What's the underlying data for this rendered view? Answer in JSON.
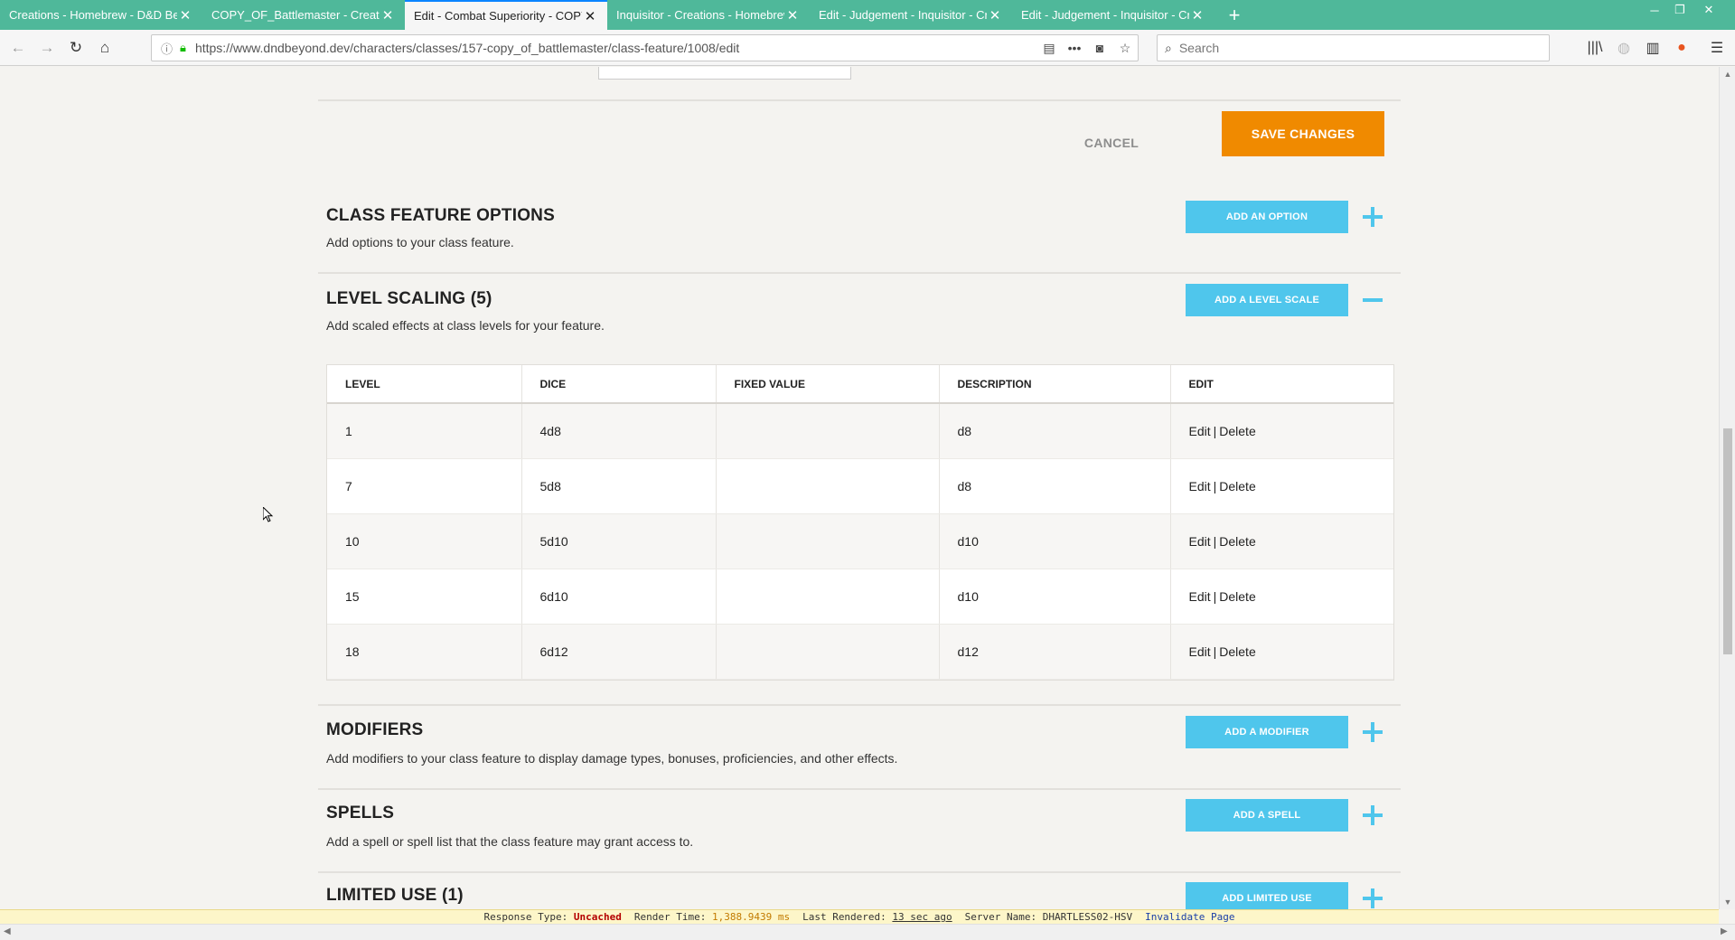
{
  "browser": {
    "tabs": [
      {
        "title": "Creations - Homebrew - D&D Beyond",
        "active": false
      },
      {
        "title": "COPY_OF_Battlemaster - Creations",
        "active": false
      },
      {
        "title": "Edit - Combat Superiority - COPY_OF",
        "active": true
      },
      {
        "title": "Inquisitor - Creations - Homebrew",
        "active": false
      },
      {
        "title": "Edit - Judgement - Inquisitor - Creations",
        "active": false
      },
      {
        "title": "Edit - Judgement - Inquisitor - Creations",
        "active": false
      }
    ],
    "url": "https://www.dndbeyond.dev/characters/classes/157-copy_of_battlemaster/class-feature/1008/edit",
    "search_placeholder": "Search"
  },
  "form_actions": {
    "cancel_label": "CANCEL",
    "save_label": "SAVE CHANGES"
  },
  "sections": {
    "options": {
      "title": "CLASS FEATURE OPTIONS",
      "description": "Add options to your class feature.",
      "button_label": "ADD AN OPTION"
    },
    "level_scaling": {
      "title": "LEVEL SCALING (5)",
      "description": "Add scaled effects at class levels for your feature.",
      "button_label": "ADD A LEVEL SCALE",
      "columns": [
        "LEVEL",
        "DICE",
        "FIXED VALUE",
        "DESCRIPTION",
        "EDIT"
      ],
      "rows": [
        {
          "level": "1",
          "dice": "4d8",
          "fixed_value": "",
          "description": "d8"
        },
        {
          "level": "7",
          "dice": "5d8",
          "fixed_value": "",
          "description": "d8"
        },
        {
          "level": "10",
          "dice": "5d10",
          "fixed_value": "",
          "description": "d10"
        },
        {
          "level": "15",
          "dice": "6d10",
          "fixed_value": "",
          "description": "d10"
        },
        {
          "level": "18",
          "dice": "6d12",
          "fixed_value": "",
          "description": "d12"
        }
      ],
      "edit_label": "Edit",
      "delete_label": "Delete",
      "separator": "|"
    },
    "modifiers": {
      "title": "MODIFIERS",
      "description": "Add modifiers to your class feature to display damage types, bonuses, proficiencies, and other effects.",
      "button_label": "ADD A MODIFIER"
    },
    "spells": {
      "title": "SPELLS",
      "description": "Add a spell or spell list that the class feature may grant access to.",
      "button_label": "ADD A SPELL"
    },
    "limited_use": {
      "title": "LIMITED USE (1)",
      "button_label": "ADD LIMITED USE"
    }
  },
  "status_bar": {
    "response_type_label": "Response Type:",
    "response_type_value": "Uncached",
    "render_time_label": "Render Time:",
    "render_time_value": "1,388.9439 ms",
    "last_rendered_label": "Last Rendered:",
    "last_rendered_value": "13 sec ago",
    "server_name_label": "Server Name:",
    "server_name_value": "DHARTLESS02-HSV",
    "invalidate_label": "Invalidate Page"
  },
  "colors": {
    "tab_bar": "#4fb89a",
    "save_button": "#f08a00",
    "action_button": "#4fc6ec",
    "page_background": "#f4f3f0"
  }
}
